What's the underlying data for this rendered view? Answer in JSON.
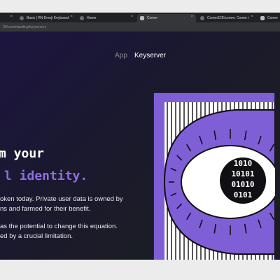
{
  "browser": {
    "tabs": [
      {
        "label": ""
      },
      {
        "label": "Basic | RN Emoji Keyboard"
      },
      {
        "label": "Home"
      },
      {
        "label": "Comm"
      },
      {
        "label": "CommE2E/comm: Comm i"
      },
      {
        "label": "Comm"
      }
    ],
    "url": "00/commlanding/keyservers"
  },
  "nav": {
    "app_label": "App",
    "keyserver_label": "Keyserver"
  },
  "hero": {
    "line1": "m your",
    "line2": "l identity.",
    "para1_line1": "oken today. Private user data is owned by",
    "para1_line2": "ns and farmed for their benefit.",
    "para2_line1": "as the potential to change this equation.",
    "para2_line2": "ed by a crucial limitation."
  },
  "illustration": {
    "binary_rows": [
      "1010",
      "10101",
      "01010",
      "0101"
    ],
    "colors": {
      "purple": "#7f5fd6",
      "ink": "#0f0f14",
      "paper": "#ffffff"
    }
  }
}
